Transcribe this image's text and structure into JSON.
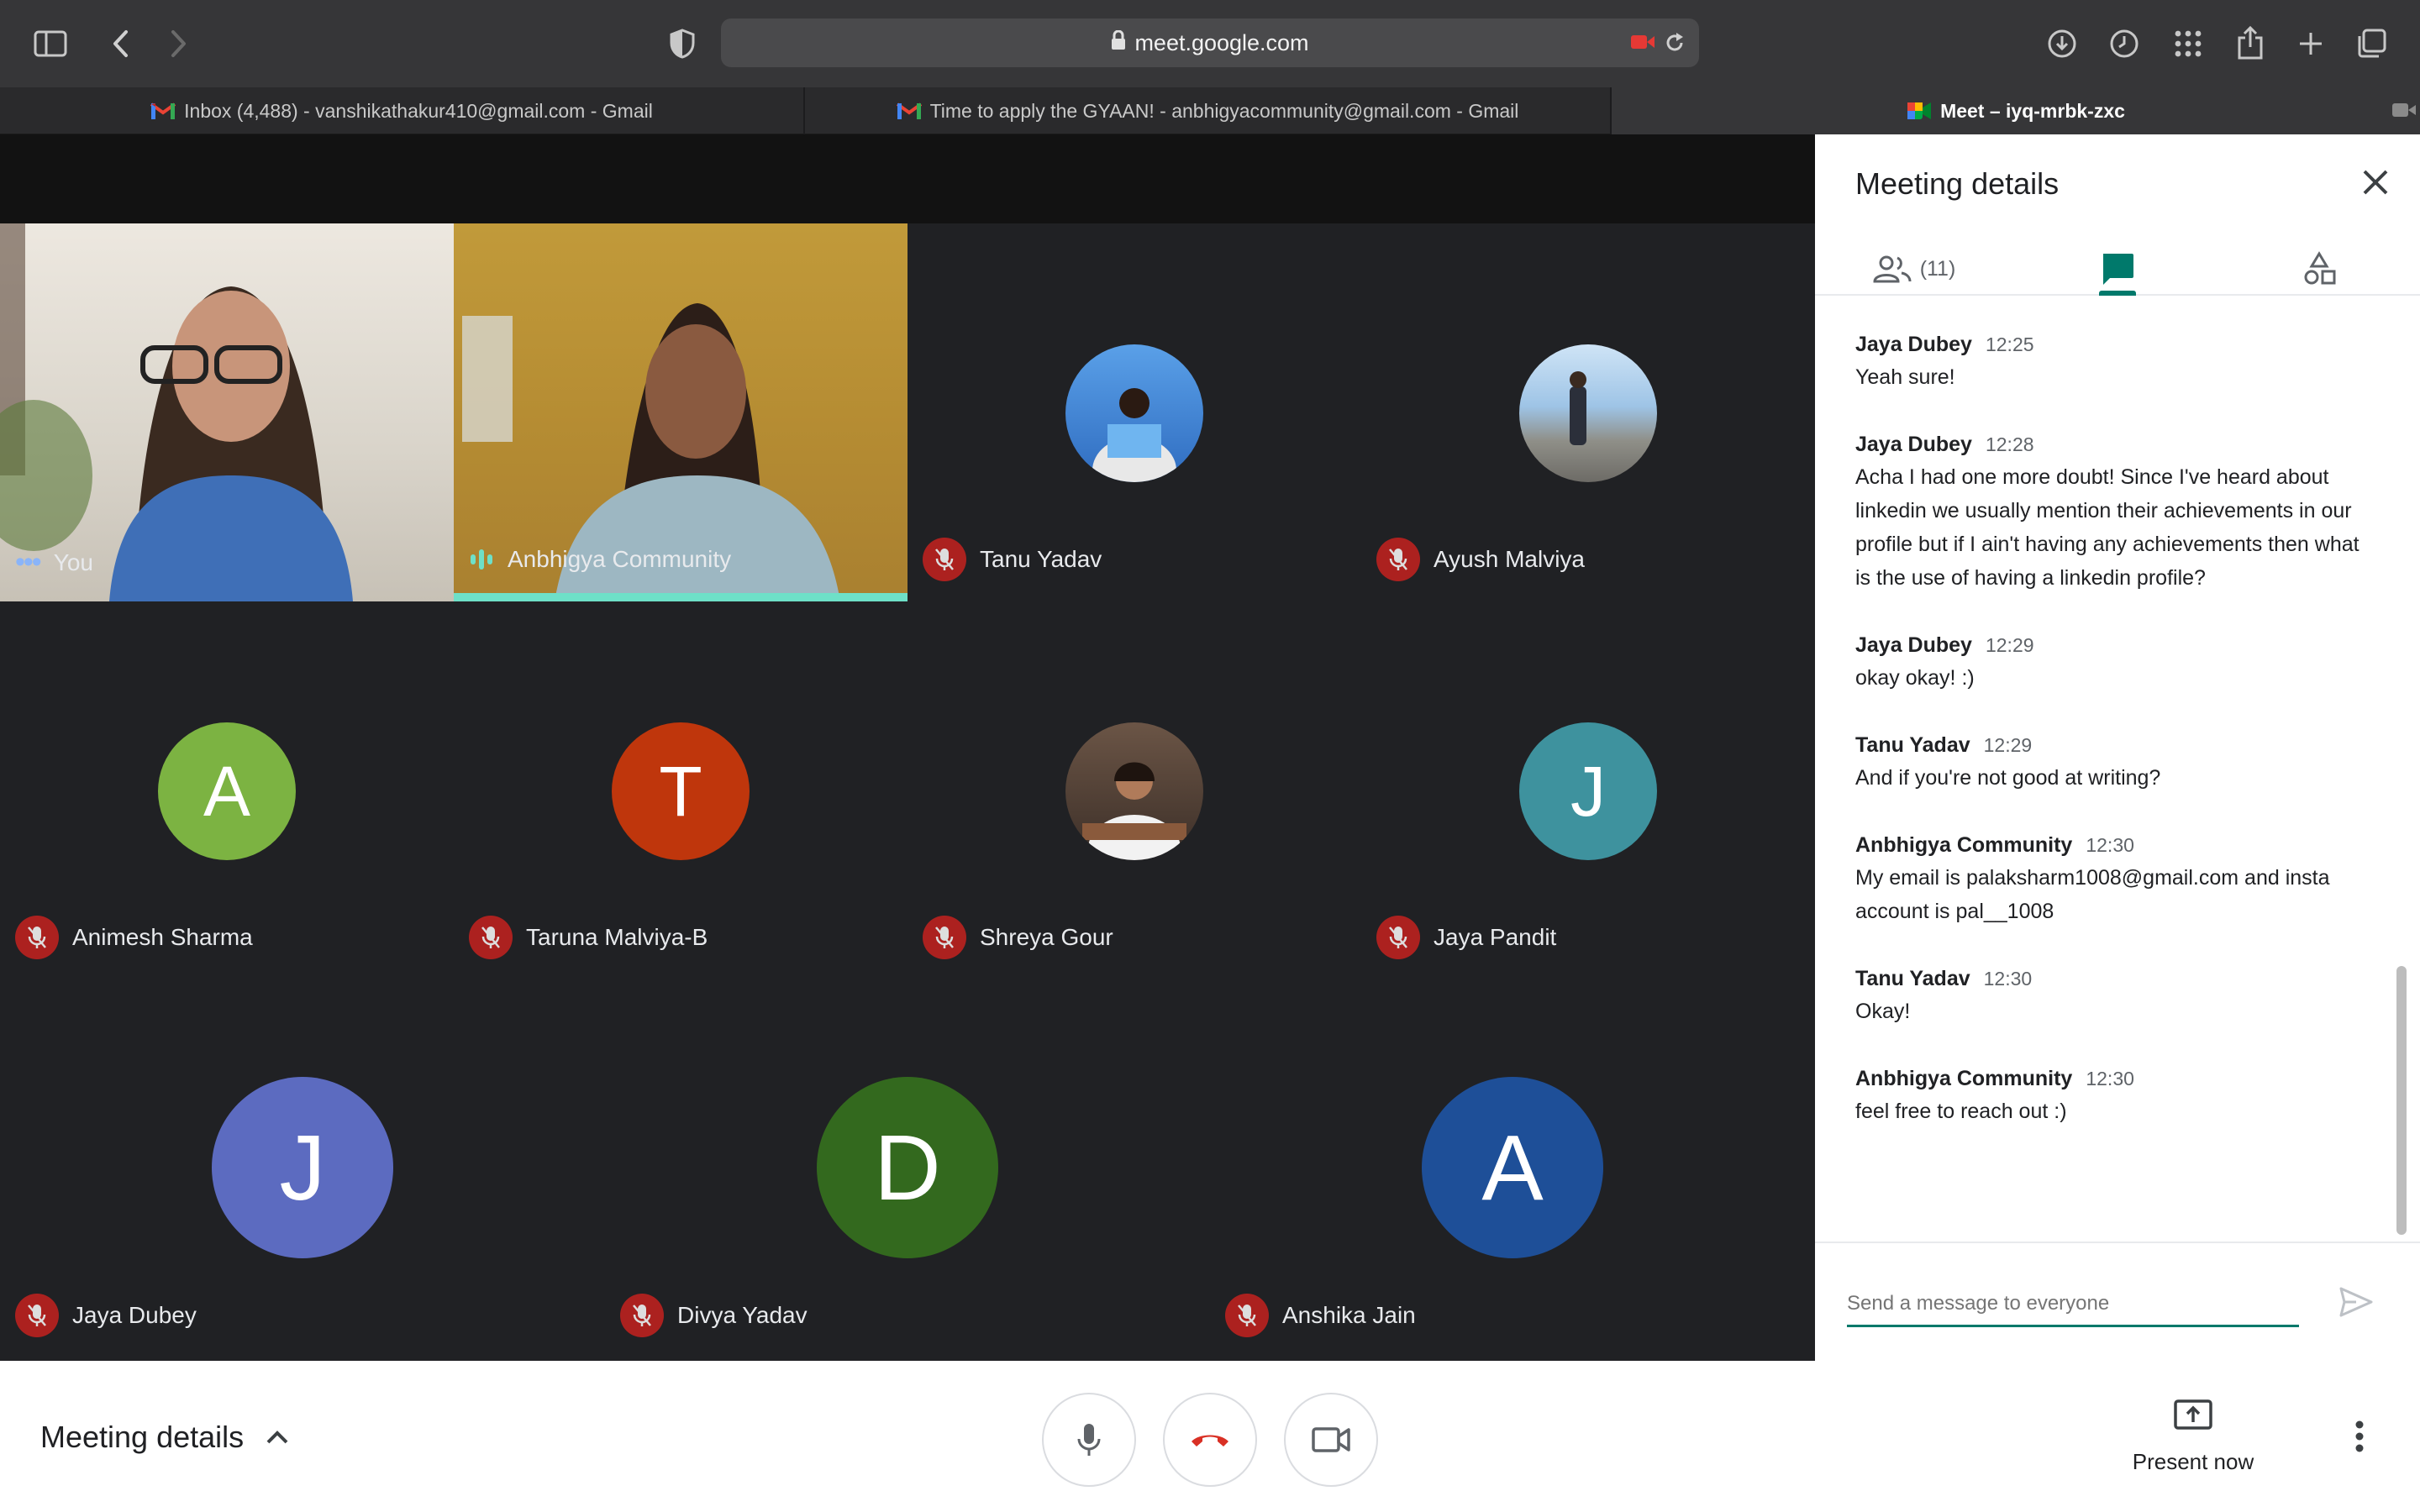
{
  "browser": {
    "url": "meet.google.com",
    "tabs": [
      {
        "label": "Inbox (4,488) - vanshikathakur410@gmail.com - Gmail",
        "icon": "gmail-icon"
      },
      {
        "label": "Time to apply the GYAAN! - anbhigyacommunity@gmail.com - Gmail",
        "icon": "gmail-icon"
      },
      {
        "label": "Meet – iyq-mrbk-zxc",
        "icon": "meet-icon"
      }
    ]
  },
  "participants": [
    {
      "name": "You",
      "initial": "",
      "color": "",
      "type": "video"
    },
    {
      "name": "Anbhigya Community",
      "initial": "",
      "color": "",
      "type": "video",
      "speaking": true
    },
    {
      "name": "Tanu Yadav",
      "initial": "",
      "color": "#3b82d6",
      "type": "photo",
      "muted": true
    },
    {
      "name": "Ayush Malviya",
      "initial": "",
      "color": "#9ec4e6",
      "type": "photo",
      "muted": true
    },
    {
      "name": "Animesh Sharma",
      "initial": "A",
      "color": "#7cb342",
      "type": "letter",
      "muted": true
    },
    {
      "name": "Taruna Malviya-B",
      "initial": "T",
      "color": "#bf360c",
      "type": "letter",
      "muted": true
    },
    {
      "name": "Shreya Gour",
      "initial": "",
      "color": "#5d4a3c",
      "type": "photo",
      "muted": true
    },
    {
      "name": "Jaya Pandit",
      "initial": "J",
      "color": "#3e929e",
      "type": "letter",
      "muted": true
    },
    {
      "name": "Jaya Dubey",
      "initial": "J",
      "color": "#5c6bc0",
      "type": "letter",
      "muted": true
    },
    {
      "name": "Divya Yadav",
      "initial": "D",
      "color": "#33691e",
      "type": "letter",
      "muted": true
    },
    {
      "name": "Anshika Jain",
      "initial": "A",
      "color": "#1e4f98",
      "type": "letter",
      "muted": true
    }
  ],
  "panel": {
    "title": "Meeting details",
    "people_count": "(11)",
    "messages": [
      {
        "sender": "Jaya Dubey",
        "time": "12:25",
        "text": "Yeah sure!"
      },
      {
        "sender": "Jaya Dubey",
        "time": "12:28",
        "text": "Acha I had one more doubt! Since I've heard about linkedin we usually mention their achievements in our profile but if I ain't having any achievements then what is the use of having a linkedin profile?"
      },
      {
        "sender": "Jaya Dubey",
        "time": "12:29",
        "text": "okay okay! :)"
      },
      {
        "sender": "Tanu Yadav",
        "time": "12:29",
        "text": "And if you're not good at writing?"
      },
      {
        "sender": "Anbhigya Community",
        "time": "12:30",
        "text": "My email is palaksharm1008@gmail.com and insta account is pal__1008"
      },
      {
        "sender": "Tanu Yadav",
        "time": "12:30",
        "text": "Okay!"
      },
      {
        "sender": "Anbhigya Community",
        "time": "12:30",
        "text": "feel free to reach out :)"
      }
    ],
    "compose_placeholder": "Send a message to everyone"
  },
  "bottombar": {
    "meeting_details": "Meeting details",
    "present_now": "Present now"
  },
  "colors": {
    "accent": "#00796b",
    "muted_red": "#c5221f",
    "speaking_bar": "#6ee0c8"
  }
}
